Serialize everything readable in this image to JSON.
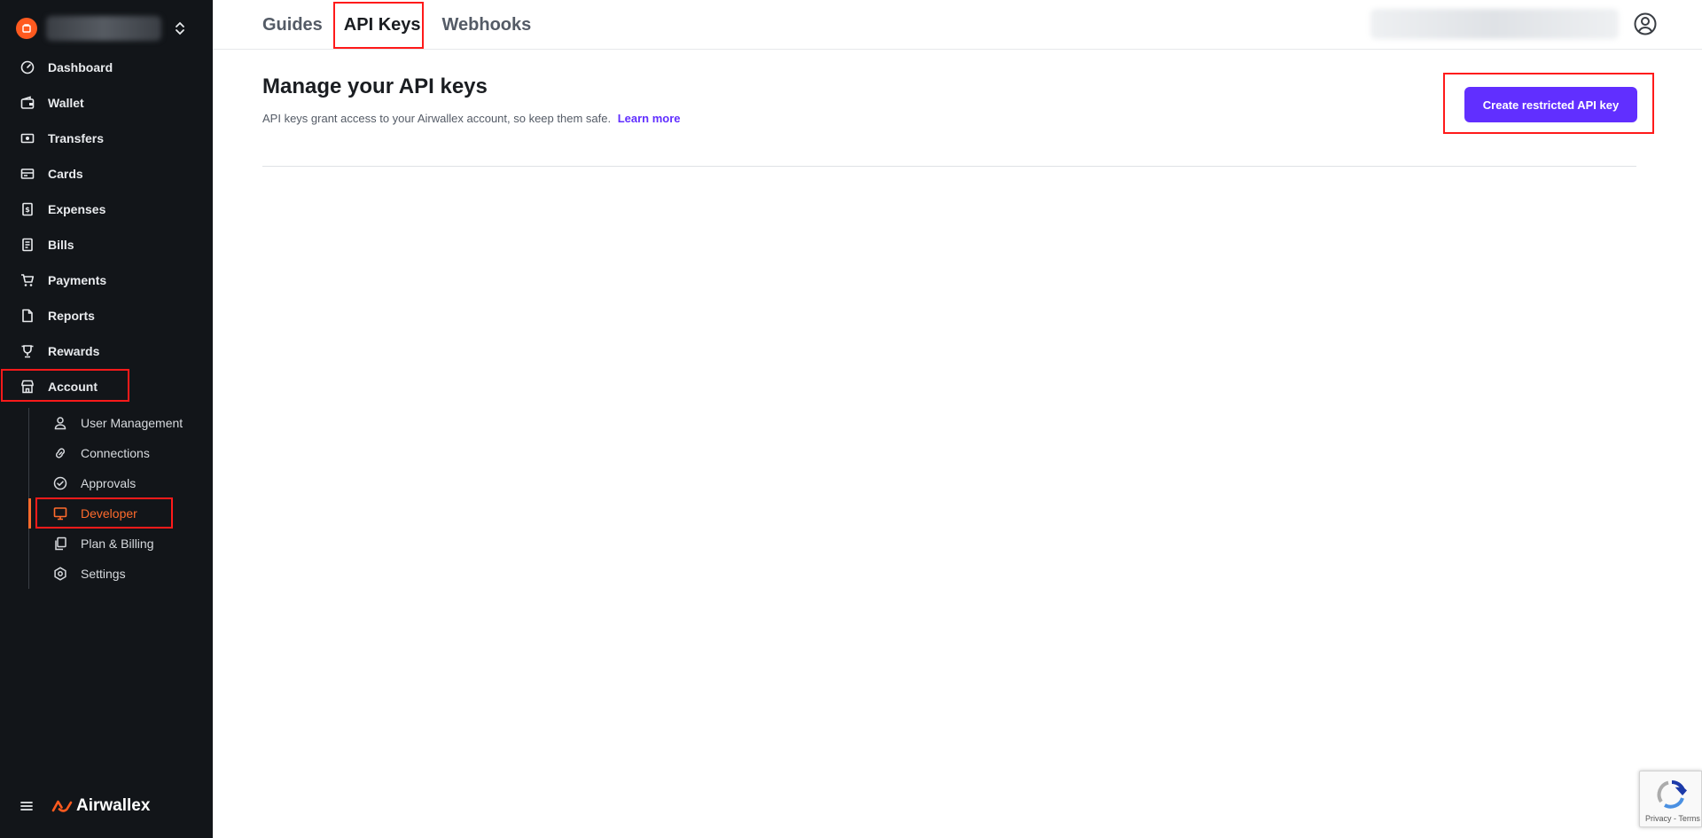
{
  "sidebar": {
    "items": [
      {
        "label": "Dashboard",
        "icon": "dashboard-gauge-icon"
      },
      {
        "label": "Wallet",
        "icon": "wallet-icon"
      },
      {
        "label": "Transfers",
        "icon": "transfers-icon"
      },
      {
        "label": "Cards",
        "icon": "card-icon"
      },
      {
        "label": "Expenses",
        "icon": "expenses-receipt-icon"
      },
      {
        "label": "Bills",
        "icon": "bills-document-icon"
      },
      {
        "label": "Payments",
        "icon": "cart-icon"
      },
      {
        "label": "Reports",
        "icon": "report-file-icon"
      },
      {
        "label": "Rewards",
        "icon": "trophy-icon"
      },
      {
        "label": "Account",
        "icon": "store-icon"
      }
    ],
    "sub_items": [
      {
        "label": "User Management",
        "icon": "user-icon"
      },
      {
        "label": "Connections",
        "icon": "link-icon"
      },
      {
        "label": "Approvals",
        "icon": "check-circle-icon"
      },
      {
        "label": "Developer",
        "icon": "monitor-icon",
        "active": true
      },
      {
        "label": "Plan & Billing",
        "icon": "copy-icon"
      },
      {
        "label": "Settings",
        "icon": "gear-icon"
      }
    ],
    "brand": "Airwallex"
  },
  "tabs": [
    {
      "label": "Guides"
    },
    {
      "label": "API Keys",
      "active": true
    },
    {
      "label": "Webhooks"
    }
  ],
  "main": {
    "title": "Manage your API keys",
    "subtitle": "API keys grant access to your Airwallex account, so keep them safe.",
    "learn_more": "Learn more",
    "create_button": "Create restricted API key"
  },
  "recaptcha": {
    "text": "Privacy - Terms"
  },
  "colors": {
    "sidebar_bg": "#121519",
    "accent": "#612fff",
    "active_orange": "#ff6b2c",
    "highlight": "#ff1a1a"
  }
}
